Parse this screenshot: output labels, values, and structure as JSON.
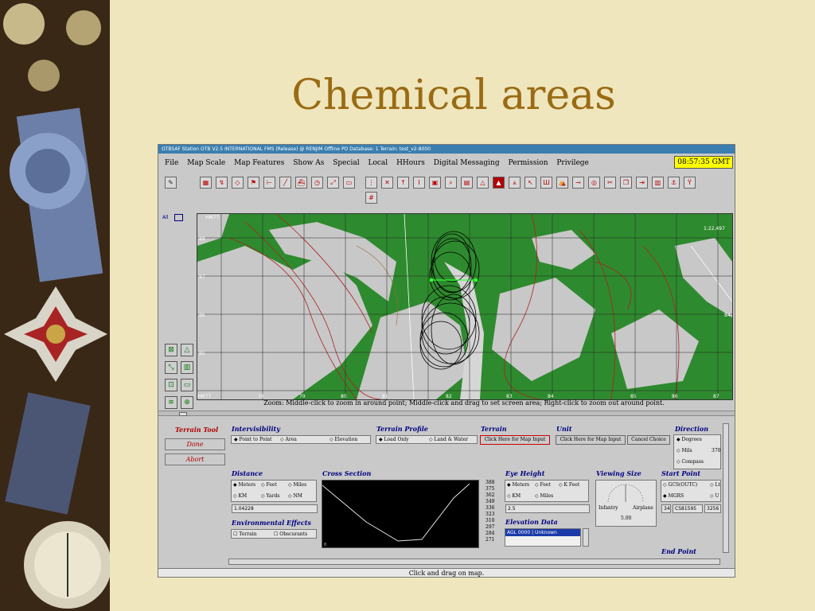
{
  "slide": {
    "title": "Chemical areas"
  },
  "app": {
    "title_bar": "OTBSAF Station OTB V2.5 INTERNATIONAL FMS (Release) @ RENJIM     Offline     PO Database: 1     Terrain: test_v2-8000",
    "clock": "08:57:35 GMT",
    "menu": [
      "File",
      "Map Scale",
      "Map Features",
      "Show As",
      "Special",
      "Local",
      "HHours",
      "Digital Messaging",
      "Permission",
      "Privilege"
    ],
    "toolbar_hash": "#",
    "side_label": "All",
    "map": {
      "scale": "1:22,497",
      "x_ticks": [
        "HM77",
        "78",
        "79",
        "80",
        "81",
        "82",
        "83",
        "84",
        "85",
        "86",
        "87"
      ],
      "y_ticks": [
        "88",
        "87",
        "86",
        "85",
        "84"
      ],
      "zoom_hint": "Zoom: Middle-click to zoom in around point; Middle-click and drag to set screen area; Right-click to zoom out around point."
    },
    "terrain_tool": {
      "title": "Terrain Tool",
      "done": "Done",
      "abort": "Abort"
    },
    "intervisibility": {
      "label": "Intervisibility",
      "options": [
        "Point to Point",
        "Area",
        "Elevation"
      ]
    },
    "terrain_profile": {
      "label": "Terrain Profile",
      "options": [
        "Load Only",
        "Land & Water"
      ]
    },
    "terrain": {
      "label": "Terrain",
      "button": "Click Here for Map Input"
    },
    "unit": {
      "label": "Unit",
      "button": "Click Here for Map Input",
      "cancel": "Cancel Choice"
    },
    "direction": {
      "label": "Direction",
      "options": [
        "Degrees",
        "Mils",
        "Compass"
      ],
      "mils_value": "370"
    },
    "distance": {
      "label": "Distance",
      "options": [
        "Meters",
        "Feet",
        "Miles",
        "KM",
        "Yards",
        "NM"
      ],
      "value": "1.04228"
    },
    "cross_section": {
      "label": "Cross Section",
      "y_ticks": [
        "388",
        "375",
        "362",
        "349",
        "336",
        "323",
        "310",
        "297",
        "284",
        "271"
      ],
      "origin": "0"
    },
    "eye_height": {
      "label": "Eye Height",
      "options": [
        "Meters",
        "Feet",
        "K Feet",
        "KM",
        "Miles"
      ],
      "value": "2.5"
    },
    "elevation_data": {
      "label": "Elevation Data",
      "value": "AGL 0000 | Unknown"
    },
    "viewing_size": {
      "label": "Viewing Size",
      "left": "Infantry",
      "right": "Airplane",
      "value": "5.00"
    },
    "start_point": {
      "label": "Start Point",
      "options": [
        "GCS(OUTC)",
        "Lt",
        "MGRS",
        "U"
      ],
      "values": [
        "34",
        "CS81595",
        "3256"
      ]
    },
    "end_point": {
      "label": "End Point"
    },
    "env_effects": {
      "label": "Environmental Effects",
      "options": [
        "Terrain",
        "Obscurants"
      ]
    },
    "status": "Click and drag on map."
  }
}
